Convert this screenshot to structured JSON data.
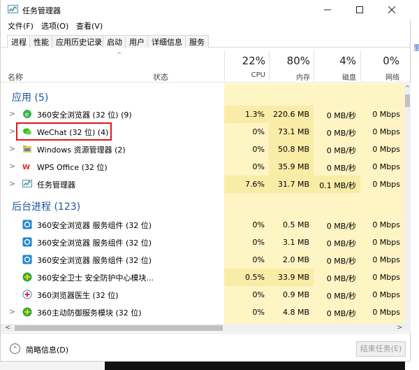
{
  "window": {
    "title": "任务管理器"
  },
  "menu": [
    "文件(F)",
    "选项(O)",
    "查看(V)"
  ],
  "tabs": [
    "进程",
    "性能",
    "应用历史记录",
    "启动",
    "用户",
    "详细信息",
    "服务"
  ],
  "header": {
    "name": "名称",
    "status": "状态",
    "cpu": {
      "pct": "22%",
      "label": "CPU"
    },
    "mem": {
      "pct": "80%",
      "label": "内存"
    },
    "disk": {
      "pct": "4%",
      "label": "磁盘"
    },
    "net": {
      "pct": "0%",
      "label": "网络"
    }
  },
  "groups": {
    "apps": "应用 (5)",
    "background": "后台进程 (123)"
  },
  "rows": [
    {
      "name": "360安全浏览器 (32 位) (9)",
      "cpu": "1.3%",
      "mem": "220.6 MB",
      "disk": "0 MB/秒",
      "net": "0 Mbps",
      "icon": "360-browser-icon"
    },
    {
      "name": "WeChat (32 位) (4)",
      "cpu": "0%",
      "mem": "73.1 MB",
      "disk": "0 MB/秒",
      "net": "0 Mbps",
      "icon": "wechat-icon"
    },
    {
      "name": "Windows 资源管理器 (2)",
      "cpu": "0%",
      "mem": "50.8 MB",
      "disk": "0 MB/秒",
      "net": "0 Mbps",
      "icon": "explorer-folder-icon"
    },
    {
      "name": "WPS Office (32 位)",
      "cpu": "0%",
      "mem": "35.9 MB",
      "disk": "0 MB/秒",
      "net": "0 Mbps",
      "icon": "wps-icon"
    },
    {
      "name": "任务管理器",
      "cpu": "7.6%",
      "mem": "31.7 MB",
      "disk": "0.1 MB/秒",
      "net": "0 Mbps",
      "icon": "task-manager-icon"
    },
    {
      "name": "360安全浏览器 服务组件 (32 位)",
      "cpu": "0%",
      "mem": "0.5 MB",
      "disk": "0 MB/秒",
      "net": "0 Mbps",
      "icon": "360-service-icon"
    },
    {
      "name": "360安全浏览器 服务组件 (32 位)",
      "cpu": "0%",
      "mem": "3.1 MB",
      "disk": "0 MB/秒",
      "net": "0 Mbps",
      "icon": "360-service-icon"
    },
    {
      "name": "360安全浏览器 服务组件 (32 位)",
      "cpu": "0%",
      "mem": "2.0 MB",
      "disk": "0 MB/秒",
      "net": "0 Mbps",
      "icon": "360-service-icon"
    },
    {
      "name": "360安全卫士 安全防护中心模块...",
      "cpu": "0.5%",
      "mem": "33.9 MB",
      "disk": "0 MB/秒",
      "net": "0 Mbps",
      "icon": "360-guard-icon"
    },
    {
      "name": "360浏览器医生 (32 位)",
      "cpu": "0%",
      "mem": "0.9 MB",
      "disk": "0 MB/秒",
      "net": "0 Mbps",
      "icon": "browser-doctor-icon"
    },
    {
      "name": "360主动防御服务模块 (32 位)",
      "cpu": "0%",
      "mem": "4.8 MB",
      "disk": "0 MB/秒",
      "net": "0 Mbps",
      "icon": "360-guard-icon"
    }
  ],
  "footer": {
    "fewer_details": "简略信息(D)",
    "end_task": "结束任务(E)"
  },
  "side_mark": "里"
}
